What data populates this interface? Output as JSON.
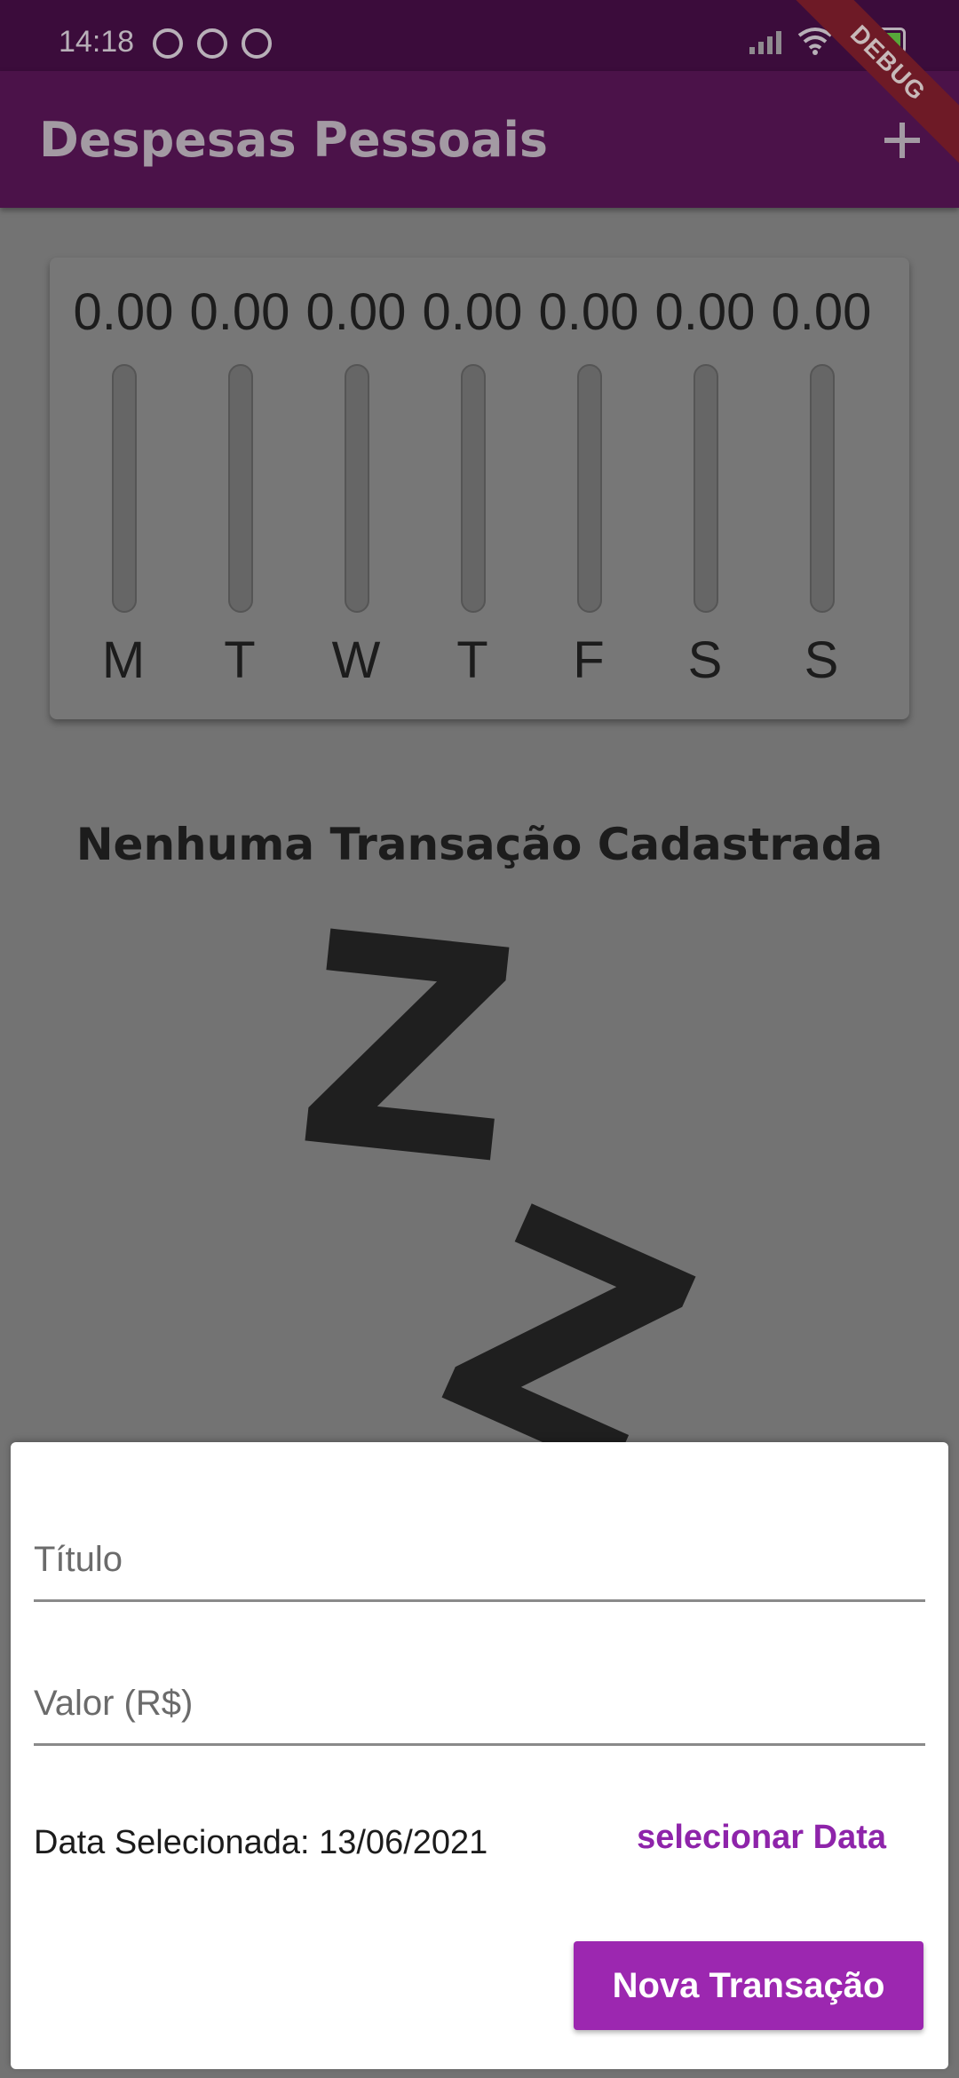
{
  "status_bar": {
    "time": "14:18",
    "battery": "99"
  },
  "app_bar": {
    "title": "Despesas Pessoais",
    "add_icon": "plus-icon"
  },
  "debug_banner": "DEBUG",
  "chart_data": {
    "type": "bar",
    "categories": [
      "M",
      "T",
      "W",
      "T",
      "F",
      "S",
      "S"
    ],
    "values": [
      0.0,
      0.0,
      0.0,
      0.0,
      0.0,
      0.0,
      0.0
    ],
    "value_labels": [
      "0.00",
      "0.00",
      "0.00",
      "0.00",
      "0.00",
      "0.00",
      "0.00"
    ],
    "fill_fraction": [
      0,
      0,
      0,
      0,
      0,
      0,
      0
    ]
  },
  "empty_state": {
    "title": "Nenhuma Transação Cadastrada",
    "z1": "Z",
    "z2": "Z"
  },
  "form": {
    "title_placeholder": "Título",
    "title_value": "",
    "value_placeholder": "Valor (R$)",
    "value_value": "",
    "date_label": "Data Selecionada: 13/06/2021",
    "select_date_label": "selecionar Data",
    "submit_label": "Nova Transação"
  },
  "colors": {
    "primary": "#9c27b0",
    "app_bar": "#4b1249",
    "accent_text": "#8e24aa"
  }
}
